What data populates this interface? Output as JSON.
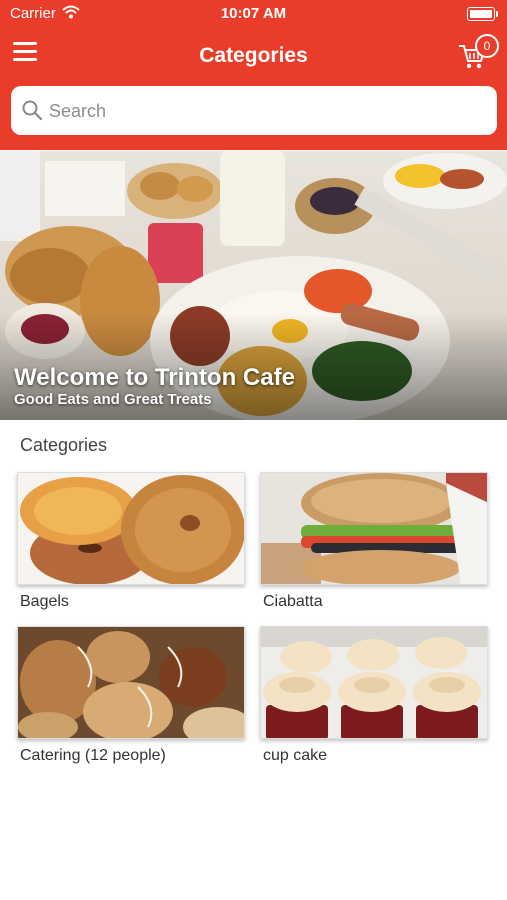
{
  "status_bar": {
    "carrier": "Carrier",
    "time": "10:07 AM"
  },
  "header": {
    "title": "Categories",
    "cart_count": "0",
    "menu_icon": "hamburger-icon",
    "cart_icon": "cart-icon"
  },
  "search": {
    "placeholder": "Search"
  },
  "hero": {
    "title": "Welcome to Trinton Cafe",
    "subtitle": "Good Eats and Great Treats"
  },
  "section": {
    "title": "Categories"
  },
  "categories": [
    {
      "label": "Bagels"
    },
    {
      "label": "Ciabatta"
    },
    {
      "label": "Catering (12 people)"
    },
    {
      "label": "cup cake"
    }
  ],
  "colors": {
    "brand": "#ea3c2a"
  }
}
